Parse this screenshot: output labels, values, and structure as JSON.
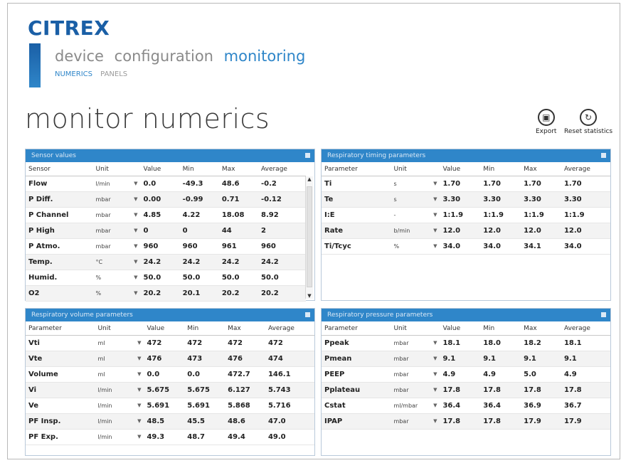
{
  "brand": "CITREX",
  "nav": {
    "items": [
      "device",
      "configuration",
      "monitoring"
    ],
    "active_index": 2
  },
  "subnav": {
    "items": [
      "NUMERICS",
      "PANELS"
    ],
    "active_index": 0
  },
  "page_title": "monitor numerics",
  "toolbar": {
    "export_label": "Export",
    "reset_label": "Reset statistics"
  },
  "colors": {
    "accent": "#2f86c9",
    "brand": "#1a5fa6"
  },
  "panels": {
    "sensor": {
      "title": "Sensor values",
      "headers": [
        "Sensor",
        "Unit",
        "Value",
        "Min",
        "Max",
        "Average"
      ],
      "rows": [
        [
          "Flow",
          "l/min",
          "0.0",
          "-49.3",
          "48.6",
          "-0.2"
        ],
        [
          "P Diff.",
          "mbar",
          "0.00",
          "-0.99",
          "0.71",
          "-0.12"
        ],
        [
          "P Channel",
          "mbar",
          "4.85",
          "4.22",
          "18.08",
          "8.92"
        ],
        [
          "P High",
          "mbar",
          "0",
          "0",
          "44",
          "2"
        ],
        [
          "P Atmo.",
          "mbar",
          "960",
          "960",
          "961",
          "960"
        ],
        [
          "Temp.",
          "°C",
          "24.2",
          "24.2",
          "24.2",
          "24.2"
        ],
        [
          "Humid.",
          "%",
          "50.0",
          "50.0",
          "50.0",
          "50.0"
        ],
        [
          "O2",
          "%",
          "20.2",
          "20.1",
          "20.2",
          "20.2"
        ]
      ]
    },
    "timing": {
      "title": "Respiratory timing parameters",
      "headers": [
        "Parameter",
        "Unit",
        "Value",
        "Min",
        "Max",
        "Average"
      ],
      "rows": [
        [
          "Ti",
          "s",
          "1.70",
          "1.70",
          "1.70",
          "1.70"
        ],
        [
          "Te",
          "s",
          "3.30",
          "3.30",
          "3.30",
          "3.30"
        ],
        [
          "I:E",
          "-",
          "1:1.9",
          "1:1.9",
          "1:1.9",
          "1:1.9"
        ],
        [
          "Rate",
          "b/min",
          "12.0",
          "12.0",
          "12.0",
          "12.0"
        ],
        [
          "Ti/Tcyc",
          "%",
          "34.0",
          "34.0",
          "34.1",
          "34.0"
        ]
      ]
    },
    "volume": {
      "title": "Respiratory volume parameters",
      "headers": [
        "Parameter",
        "Unit",
        "Value",
        "Min",
        "Max",
        "Average"
      ],
      "rows": [
        [
          "Vti",
          "ml",
          "472",
          "472",
          "472",
          "472"
        ],
        [
          "Vte",
          "ml",
          "476",
          "473",
          "476",
          "474"
        ],
        [
          "Volume",
          "ml",
          "0.0",
          "0.0",
          "472.7",
          "146.1"
        ],
        [
          "Vi",
          "l/min",
          "5.675",
          "5.675",
          "6.127",
          "5.743"
        ],
        [
          "Ve",
          "l/min",
          "5.691",
          "5.691",
          "5.868",
          "5.716"
        ],
        [
          "PF Insp.",
          "l/min",
          "48.5",
          "45.5",
          "48.6",
          "47.0"
        ],
        [
          "PF Exp.",
          "l/min",
          "49.3",
          "48.7",
          "49.4",
          "49.0"
        ]
      ]
    },
    "pressure": {
      "title": "Respiratory pressure parameters",
      "headers": [
        "Parameter",
        "Unit",
        "Value",
        "Min",
        "Max",
        "Average"
      ],
      "rows": [
        [
          "Ppeak",
          "mbar",
          "18.1",
          "18.0",
          "18.2",
          "18.1"
        ],
        [
          "Pmean",
          "mbar",
          "9.1",
          "9.1",
          "9.1",
          "9.1"
        ],
        [
          "PEEP",
          "mbar",
          "4.9",
          "4.9",
          "5.0",
          "4.9"
        ],
        [
          "Pplateau",
          "mbar",
          "17.8",
          "17.8",
          "17.8",
          "17.8"
        ],
        [
          "Cstat",
          "ml/mbar",
          "36.4",
          "36.4",
          "36.9",
          "36.7"
        ],
        [
          "IPAP",
          "mbar",
          "17.8",
          "17.8",
          "17.9",
          "17.9"
        ]
      ]
    }
  }
}
